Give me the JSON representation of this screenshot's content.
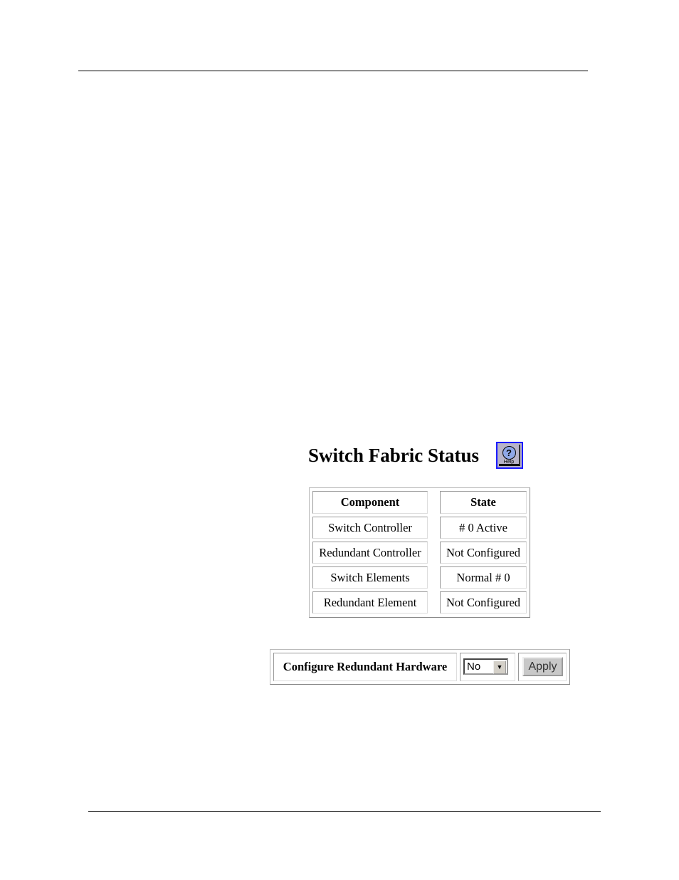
{
  "title": "Switch Fabric Status",
  "help": {
    "icon": "help-icon",
    "label": "Help"
  },
  "table": {
    "headers": [
      "Component",
      "State"
    ],
    "rows": [
      [
        "Switch Controller",
        "# 0 Active"
      ],
      [
        "Redundant Controller",
        "Not Configured"
      ],
      [
        "Switch Elements",
        "Normal # 0"
      ],
      [
        "Redundant Element",
        "Not Configured"
      ]
    ]
  },
  "config": {
    "label": "Configure Redundant Hardware",
    "select_value": "No",
    "apply_label": "Apply"
  }
}
